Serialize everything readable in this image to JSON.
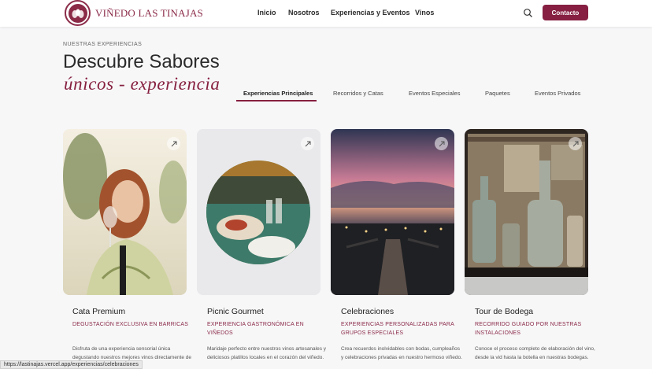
{
  "header": {
    "brand": "VIÑEDO LAS TINAJAS",
    "nav": [
      "Inicio",
      "Nosotros",
      "Experiencias y Eventos",
      "Vinos"
    ],
    "contact_label": "Contacto",
    "accent": "#861f42"
  },
  "section": {
    "eyebrow": "NUESTRAS EXPERIENCIAS",
    "title_line1": "Descubre Sabores",
    "title_line2": "únicos - experiencia"
  },
  "tabs": [
    {
      "label": "Experiencias Principales",
      "active": true
    },
    {
      "label": "Recorridos y Catas",
      "active": false
    },
    {
      "label": "Eventos Especiales",
      "active": false
    },
    {
      "label": "Paquetes",
      "active": false
    },
    {
      "label": "Eventos Privados",
      "active": false
    }
  ],
  "cards": [
    {
      "title": "Cata Premium",
      "subtitle": "DEGUSTACIÓN EXCLUSIVA EN BARRICAS",
      "description": "Disfruta de una experiencia sensorial única degustando nuestros mejores vinos directamente de las barricas de roble."
    },
    {
      "title": "Picnic Gourmet",
      "subtitle": "EXPERIENCIA GASTRONÓMICA EN VIÑEDOS",
      "description": "Maridaje perfecto entre nuestros vinos artesanales y deliciosos platillos locales en el corazón del viñedo."
    },
    {
      "title": "Celebraciones",
      "subtitle": "EXPERIENCIAS PERSONALIZADAS PARA GRUPOS ESPECIALES",
      "description": "Crea recuerdos inolvidables con bodas, cumpleaños y celebraciones privadas en nuestro hermoso viñedo."
    },
    {
      "title": "Tour de Bodega",
      "subtitle": "RECORRIDO GUIADO POR NUESTRAS INSTALACIONES",
      "description": "Conoce el proceso completo de elaboración del vino, desde la vid hasta la botella en nuestras bodegas."
    }
  ],
  "status_url": "https://lastinajas.vercel.app/experiencias/celebraciones"
}
